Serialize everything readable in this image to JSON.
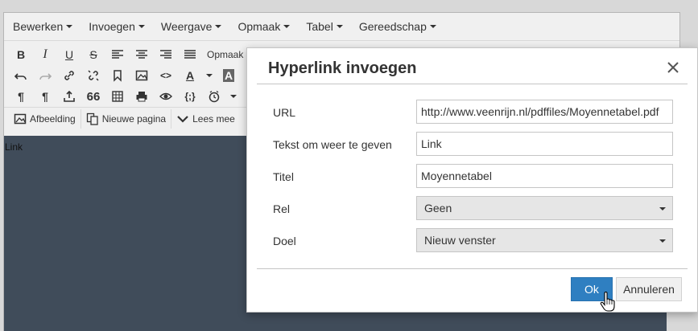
{
  "menubar": {
    "items": [
      {
        "label": "Bewerken"
      },
      {
        "label": "Invoegen"
      },
      {
        "label": "Weergave"
      },
      {
        "label": "Opmaak"
      },
      {
        "label": "Tabel"
      },
      {
        "label": "Gereedschap"
      }
    ]
  },
  "toolbar": {
    "bold": "B",
    "italic": "I",
    "underline": "U",
    "strike": "S",
    "formats_label": "Opmaak",
    "pilcrow1": "¶",
    "pilcrow2": "¶",
    "quote": "66",
    "code": "<>",
    "template": "{;}",
    "font_color": "A",
    "bg_color": "A",
    "image_label": "Afbeelding",
    "new_page_label": "Nieuwe pagina",
    "read_more_label": "Lees mee"
  },
  "editor": {
    "content_text": "Link"
  },
  "dialog": {
    "title": "Hyperlink invoegen",
    "fields": {
      "url_label": "URL",
      "url_value": "http://www.veenrijn.nl/pdffiles/Moyennetabel.pdf",
      "text_label": "Tekst om weer te geven",
      "text_value": "Link",
      "title_label": "Titel",
      "title_value": "Moyennetabel",
      "rel_label": "Rel",
      "rel_value": "Geen",
      "target_label": "Doel",
      "target_value": "Nieuw venster"
    },
    "ok_label": "Ok",
    "cancel_label": "Annuleren"
  },
  "colors": {
    "primary_button": "#2f7fc1",
    "editor_background": "#404c5a"
  }
}
